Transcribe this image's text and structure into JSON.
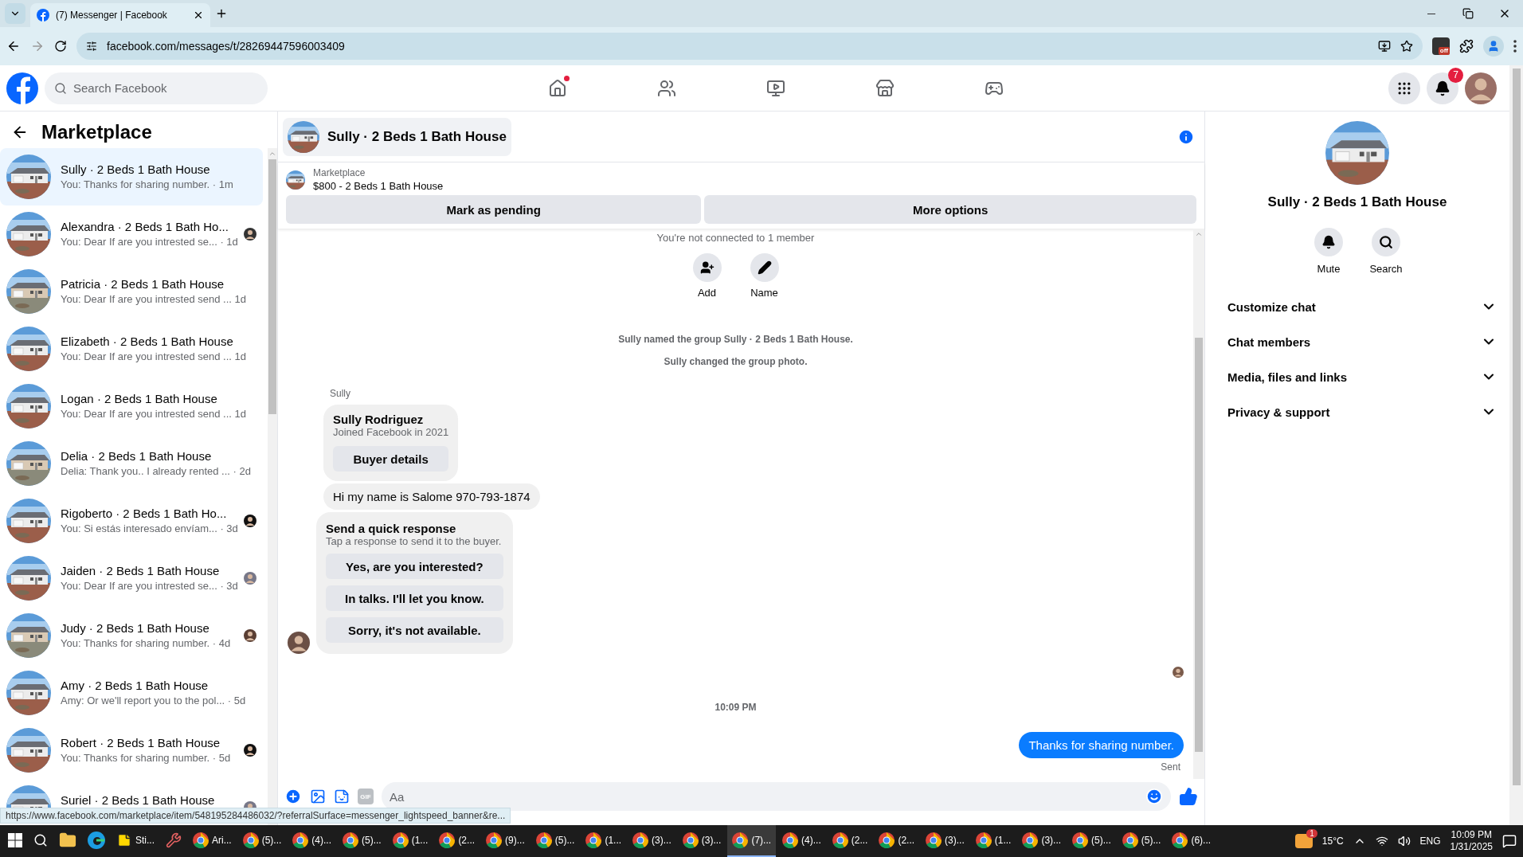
{
  "browser": {
    "tab_title": "(7) Messenger | Facebook",
    "url": "facebook.com/messages/t/28269447596003409",
    "extension_badge": "off"
  },
  "topbar": {
    "search_placeholder": "Search Facebook",
    "nav": [
      {
        "kind": "home",
        "dot": true
      },
      {
        "kind": "friends",
        "dot": false
      },
      {
        "kind": "video",
        "dot": false
      },
      {
        "kind": "marketplace",
        "dot": false
      },
      {
        "kind": "gaming",
        "dot": false
      }
    ],
    "notification_count": "7"
  },
  "sidebar": {
    "title": "Marketplace",
    "conversations": [
      {
        "name": "Sully · 2 Beds 1 Bath House",
        "preview": "You: Thanks for sharing number. · 1m",
        "selected": true,
        "seen_avatar": false
      },
      {
        "name": "Alexandra · 2 Beds 1 Bath Ho...",
        "preview": "You: Dear If are you intrested se... · 1d",
        "selected": false,
        "seen_avatar": true
      },
      {
        "name": "Patricia · 2 Beds 1 Bath House",
        "preview": "You: Dear If are you intrested send ... 1d",
        "selected": false,
        "seen_avatar": false
      },
      {
        "name": "Elizabeth · 2 Beds 1 Bath House",
        "preview": "You: Dear If are you intrested send ... 1d",
        "selected": false,
        "seen_avatar": false
      },
      {
        "name": "Logan · 2 Beds 1 Bath House",
        "preview": "You: Dear If are you intrested send ... 1d",
        "selected": false,
        "seen_avatar": false
      },
      {
        "name": "Delia · 2 Beds 1 Bath House",
        "preview": "Delia: Thank you.. I already rented ... · 2d",
        "selected": false,
        "seen_avatar": false
      },
      {
        "name": "Rigoberto · 2 Beds 1 Bath Ho...",
        "preview": "You: Si estás interesado envíam... · 3d",
        "selected": false,
        "seen_avatar": true
      },
      {
        "name": "Jaiden · 2 Beds 1 Bath House",
        "preview": "You: Dear If are you intrested se... · 3d",
        "selected": false,
        "seen_avatar": true
      },
      {
        "name": "Judy · 2 Beds 1 Bath House",
        "preview": "You: Thanks for sharing number. · 4d",
        "selected": false,
        "seen_avatar": true
      },
      {
        "name": "Amy · 2 Beds 1 Bath House",
        "preview": "Amy: Or we'll report you to the pol... · 5d",
        "selected": false,
        "seen_avatar": false
      },
      {
        "name": "Robert · 2 Beds 1 Bath House",
        "preview": "You: Thanks for sharing number. · 5d",
        "selected": false,
        "seen_avatar": true
      },
      {
        "name": "Suriel · 2 Beds 1 Bath House",
        "selected": false,
        "seen_avatar": true
      }
    ]
  },
  "chat": {
    "title": "Sully · 2 Beds 1 Bath House",
    "listing": {
      "source": "Marketplace",
      "title": "$800 - 2 Beds 1 Bath House"
    },
    "actions": [
      "Mark as pending",
      "More options"
    ],
    "messages": [
      {
        "kind": "system",
        "text": "You're not connected to 1 member"
      },
      {
        "kind": "group_actions",
        "items": [
          {
            "kind": "add",
            "label": "Add"
          },
          {
            "kind": "name",
            "label": "Name"
          }
        ]
      },
      {
        "kind": "event",
        "text": "Sully named the group Sully · 2 Beds 1 Bath House."
      },
      {
        "kind": "event",
        "text": "Sully changed the group photo."
      },
      {
        "kind": "sender",
        "text": "Sully"
      },
      {
        "kind": "buyer_card",
        "name": "Sully Rodriguez",
        "subtitle": "Joined Facebook in 2021",
        "button": "Buyer details"
      },
      {
        "kind": "incoming",
        "text": "Hi my name is Salome 970-793-1874"
      },
      {
        "kind": "quick_response",
        "title": "Send a quick response",
        "hint": "Tap a response to send it to the buyer.",
        "options": [
          "Yes, are you interested?",
          "In talks. I'll let you know.",
          "Sorry, it's not available."
        ]
      },
      {
        "kind": "seen"
      },
      {
        "kind": "time",
        "text": "10:09 PM"
      },
      {
        "kind": "outgoing",
        "text": "Thanks for sharing number.",
        "status": "Sent"
      }
    ],
    "gif_label": "GIF",
    "composer_placeholder": "Aa"
  },
  "details": {
    "name": "Sully · 2 Beds 1 Bath House",
    "actions": [
      {
        "kind": "mute",
        "label": "Mute"
      },
      {
        "kind": "search",
        "label": "Search"
      }
    ],
    "sections": [
      {
        "label": "Customize chat",
        "expanded": false
      },
      {
        "label": "Chat members",
        "expanded": false
      },
      {
        "label": "Media, files and links",
        "expanded": false
      },
      {
        "label": "Privacy & support",
        "expanded": false
      }
    ]
  },
  "status_url": "https://www.facebook.com/marketplace/item/548195284486032/?referralSurface=messenger_lightspeed_banner&re...",
  "taskbar": {
    "apps": [
      {
        "kind": "explorer"
      },
      {
        "kind": "edge"
      },
      {
        "kind": "sticky",
        "label": "Sti..."
      },
      {
        "kind": "tool"
      },
      {
        "kind": "chrome",
        "label": "Ari...",
        "selected": false
      },
      {
        "kind": "chrome",
        "label": "(5)...",
        "selected": false
      },
      {
        "kind": "chrome",
        "label": "(4)...",
        "selected": false
      },
      {
        "kind": "chrome",
        "label": "(5)...",
        "selected": false
      },
      {
        "kind": "chrome",
        "label": "(1...",
        "selected": false
      },
      {
        "kind": "chrome",
        "label": "(2...",
        "selected": false
      },
      {
        "kind": "chrome",
        "label": "(9)...",
        "selected": false
      },
      {
        "kind": "chrome",
        "label": "(5)...",
        "selected": false
      },
      {
        "kind": "chrome",
        "label": "(1...",
        "selected": false
      },
      {
        "kind": "chrome",
        "label": "(3)...",
        "selected": false
      },
      {
        "kind": "chrome",
        "label": "(3)...",
        "selected": false
      },
      {
        "kind": "chrome",
        "label": "(7)...",
        "selected": true
      },
      {
        "kind": "chrome",
        "label": "(4)...",
        "selected": false
      },
      {
        "kind": "chrome",
        "label": "(2...",
        "selected": false
      },
      {
        "kind": "chrome",
        "label": "(2...",
        "selected": false
      },
      {
        "kind": "chrome",
        "label": "(3)...",
        "selected": false
      },
      {
        "kind": "chrome",
        "label": "(1...",
        "selected": false
      },
      {
        "kind": "chrome",
        "label": "(3)...",
        "selected": false
      },
      {
        "kind": "chrome",
        "label": "(5)...",
        "selected": false
      },
      {
        "kind": "chrome",
        "label": "(5)...",
        "selected": false
      },
      {
        "kind": "chrome",
        "label": "(6)...",
        "selected": false
      }
    ],
    "weather_badge": "1",
    "temperature": "15°C",
    "language": "ENG",
    "time": "10:09 PM",
    "date": "1/31/2025"
  }
}
